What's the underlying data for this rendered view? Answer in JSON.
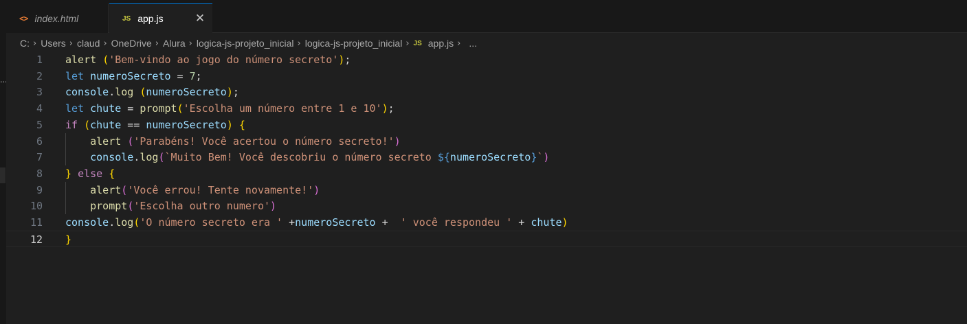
{
  "tabs": [
    {
      "icon": "<>",
      "label": "index.html",
      "active": false
    },
    {
      "icon": "JS",
      "label": "app.js",
      "active": true,
      "close": "✕"
    }
  ],
  "breadcrumb": {
    "parts": [
      "C:",
      "Users",
      "claud",
      "OneDrive",
      "Alura",
      "logica-js-projeto_inicial",
      "logica-js-projeto_inicial"
    ],
    "file_icon": "JS",
    "file": "app.js",
    "ellipsis": "..."
  },
  "left_gutter_ellipsis": "...",
  "editor": {
    "active_line": 12,
    "lines": [
      {
        "number": "1",
        "tokens": [
          [
            "alert ",
            "f"
          ],
          [
            "(",
            "p1"
          ],
          [
            "'Bem-vindo ao jogo do número secreto'",
            "s"
          ],
          [
            ")",
            "p1"
          ],
          [
            ";",
            "o"
          ]
        ]
      },
      {
        "number": "2",
        "tokens": [
          [
            "let ",
            "k"
          ],
          [
            "numeroSecreto",
            "v"
          ],
          [
            " = ",
            "o"
          ],
          [
            "7",
            "n"
          ],
          [
            ";",
            "o"
          ]
        ]
      },
      {
        "number": "3",
        "tokens": [
          [
            "console",
            "v"
          ],
          [
            ".",
            "o"
          ],
          [
            "log ",
            "f"
          ],
          [
            "(",
            "p1"
          ],
          [
            "numeroSecreto",
            "v"
          ],
          [
            ")",
            "p1"
          ],
          [
            ";",
            "o"
          ]
        ]
      },
      {
        "number": "4",
        "tokens": [
          [
            "let ",
            "k"
          ],
          [
            "chute",
            "v"
          ],
          [
            " = ",
            "o"
          ],
          [
            "prompt",
            "f"
          ],
          [
            "(",
            "p1"
          ],
          [
            "'Escolha um número entre 1 e 10'",
            "s"
          ],
          [
            ")",
            "p1"
          ],
          [
            ";",
            "o"
          ]
        ]
      },
      {
        "number": "5",
        "tokens": [
          [
            "if ",
            "kc"
          ],
          [
            "(",
            "p1"
          ],
          [
            "chute",
            "v"
          ],
          [
            " == ",
            "o"
          ],
          [
            "numeroSecreto",
            "v"
          ],
          [
            ") ",
            "p1"
          ],
          [
            "{",
            "p1"
          ]
        ]
      },
      {
        "number": "6",
        "tokens": [
          [
            "    ",
            "o"
          ],
          [
            "alert ",
            "f"
          ],
          [
            "(",
            "p2"
          ],
          [
            "'Parabéns! Você acertou o número secreto!'",
            "s"
          ],
          [
            ")",
            "p2"
          ]
        ]
      },
      {
        "number": "7",
        "tokens": [
          [
            "    ",
            "o"
          ],
          [
            "console",
            "v"
          ],
          [
            ".",
            "o"
          ],
          [
            "log",
            "f"
          ],
          [
            "(",
            "p2"
          ],
          [
            "`Muito Bem! Você descobriu o número secreto ",
            "s"
          ],
          [
            "${",
            "k"
          ],
          [
            "numeroSecreto",
            "v"
          ],
          [
            "}",
            "k"
          ],
          [
            "`",
            "s"
          ],
          [
            ")",
            "p2"
          ]
        ]
      },
      {
        "number": "8",
        "tokens": [
          [
            "} ",
            "p1"
          ],
          [
            "else ",
            "kc"
          ],
          [
            "{",
            "p1"
          ]
        ]
      },
      {
        "number": "9",
        "tokens": [
          [
            "    ",
            "o"
          ],
          [
            "alert",
            "f"
          ],
          [
            "(",
            "p2"
          ],
          [
            "'Você errou! Tente novamente!'",
            "s"
          ],
          [
            ")",
            "p2"
          ]
        ]
      },
      {
        "number": "10",
        "tokens": [
          [
            "    ",
            "o"
          ],
          [
            "prompt",
            "f"
          ],
          [
            "(",
            "p2"
          ],
          [
            "'Escolha outro numero'",
            "s"
          ],
          [
            ")",
            "p2"
          ]
        ]
      },
      {
        "number": "11",
        "tokens": [
          [
            "console",
            "v"
          ],
          [
            ".",
            "o"
          ],
          [
            "log",
            "f"
          ],
          [
            "(",
            "p1"
          ],
          [
            "'O número secreto era '",
            "s"
          ],
          [
            " +",
            "o"
          ],
          [
            "numeroSecreto",
            "v"
          ],
          [
            " +  ",
            "o"
          ],
          [
            "' você respondeu '",
            "s"
          ],
          [
            " + ",
            "o"
          ],
          [
            "chute",
            "v"
          ],
          [
            ")",
            "p1"
          ]
        ]
      },
      {
        "number": "12",
        "tokens": [
          [
            "}",
            "p1"
          ]
        ]
      }
    ]
  }
}
